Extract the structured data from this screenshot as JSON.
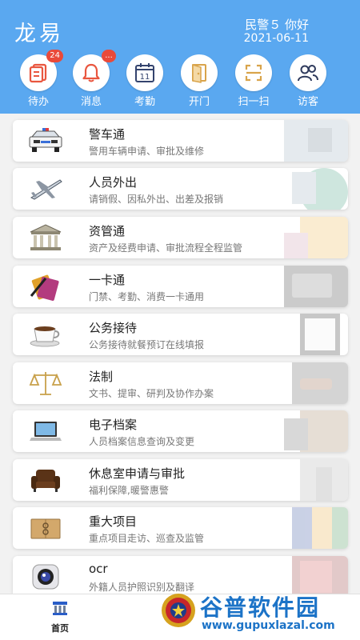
{
  "header": {
    "app_title": "龙易",
    "user_name": "民警５ 你好",
    "date": "2021-06-11",
    "quick_actions": [
      {
        "label": "待办",
        "icon": "todo-list-icon",
        "badge": "24"
      },
      {
        "label": "消息",
        "icon": "bell-icon",
        "badge": "..."
      },
      {
        "label": "考勤",
        "icon": "calendar-icon",
        "calendar_day": "11"
      },
      {
        "label": "开门",
        "icon": "door-icon"
      },
      {
        "label": "扫一扫",
        "icon": "scan-icon"
      },
      {
        "label": "访客",
        "icon": "visitors-icon"
      }
    ]
  },
  "services": [
    {
      "title": "警车通",
      "desc": "警用车辆申请、审批及维修",
      "icon": "police-car-icon"
    },
    {
      "title": "人员外出",
      "desc": "请销假、因私外出、出差及报销",
      "icon": "airplane-icon"
    },
    {
      "title": "资管通",
      "desc": "资产及经费申请、审批流程全程监管",
      "icon": "bank-icon"
    },
    {
      "title": "一卡通",
      "desc": "门禁、考勤、消费一卡通用",
      "icon": "cards-pen-icon"
    },
    {
      "title": "公务接待",
      "desc": "公务接待就餐预订在线填报",
      "icon": "coffee-cup-icon"
    },
    {
      "title": "法制",
      "desc": "文书、提审、研判及协作办案",
      "icon": "scales-icon"
    },
    {
      "title": "电子档案",
      "desc": "人员档案信息查询及变更",
      "icon": "laptop-icon"
    },
    {
      "title": "休息室申请与审批",
      "desc": "福利保障,暖警惠警",
      "icon": "armchair-icon"
    },
    {
      "title": "重大项目",
      "desc": "重点项目走访、巡查及监管",
      "icon": "envelope-icon"
    },
    {
      "title": "ocr",
      "desc": "外籍人员护照识别及翻译",
      "icon": "camera-icon"
    }
  ],
  "tabbar": {
    "home_label": "首页"
  },
  "watermark": {
    "brand": "谷普软件园",
    "url": "www.gupuxlazal.com"
  },
  "colors": {
    "header": "#5aa8f0",
    "accent": "#e94a3a",
    "watermark": "#1c73c7"
  }
}
